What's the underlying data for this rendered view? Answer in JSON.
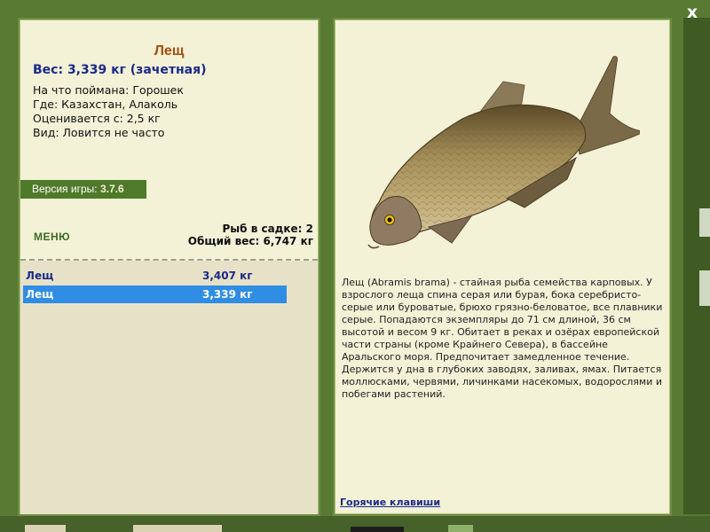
{
  "window": {
    "close_label": "x"
  },
  "fish": {
    "title": "Лещ",
    "weight_line": "Вес: 3,339 кг (зачетная)",
    "caught_on": "На что поймана: Горошек",
    "location": "Где: Казахстан, Алаколь",
    "rated_from": "Оценивается с: 2,5 кг",
    "rarity": "Вид: Ловится не часто",
    "image_icon": "bream-fish-image"
  },
  "version": {
    "label": "Версия игры:",
    "value": "3.7.6"
  },
  "menu": {
    "label": "МЕНЮ"
  },
  "cage": {
    "count_line": "Рыб в садке: 2",
    "total_line": "Общий вес: 6,747 кг"
  },
  "catch_list": [
    {
      "name": "Лещ",
      "weight": "3,407 кг",
      "selected": false
    },
    {
      "name": "Лещ",
      "weight": "3,339 кг",
      "selected": true
    }
  ],
  "description": "Лещ (Abramis brama) - стайная рыба семейства карповых. У взрослого леща спина серая или бурая, бока серебристо-серые или буроватые, брюхо грязно-беловатое, все плавники серые. Попадаются экземпляры до 71 см длиной, 36 см высотой и весом 9 кг. Обитает в реках и озёрах европейской части страны (кроме Крайнего Севера), в бассейне Аральского моря. Предпочитает замедленное течение. Держится у дна в глубоких заводях, заливах, ямах. Питается моллюсками, червями, личинками насекомых, водорослями и побегами растений.",
  "hotkeys": {
    "label": "Горячие клавиши"
  },
  "colors": {
    "background": "#587a32",
    "panel": "#f3f1d6",
    "title": "#a24e12",
    "text_blue": "#1b2a8a",
    "selection": "#2f8de4",
    "version_badge": "#4f7a2a"
  }
}
